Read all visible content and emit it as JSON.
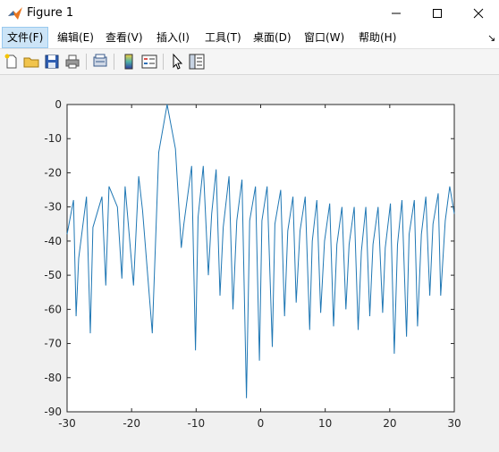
{
  "window": {
    "title": "Figure 1",
    "minimize_glyph": "—",
    "maximize_glyph": "☐",
    "close_glyph": "✕"
  },
  "menu": {
    "items": [
      "文件(F)",
      "编辑(E)",
      "查看(V)",
      "插入(I)",
      "工具(T)",
      "桌面(D)",
      "窗口(W)",
      "帮助(H)"
    ],
    "overflow_glyph": "↘"
  },
  "toolbar": {
    "icons": [
      "new-figure-icon",
      "open-file-icon",
      "save-icon",
      "print-icon",
      "print-preview-icon",
      "colorbar-icon",
      "legend-icon",
      "pointer-icon",
      "property-inspector-icon"
    ]
  },
  "colors": {
    "series": "#1f77b4",
    "axes": "#262626",
    "menu_active": "#cce4f7"
  },
  "chart_data": {
    "type": "line",
    "xlim": [
      -30,
      30
    ],
    "ylim": [
      -90,
      0
    ],
    "xticks": [
      "-30",
      "-20",
      "-10",
      "0",
      "10",
      "20",
      "30"
    ],
    "yticks": [
      "0",
      "-10",
      "-20",
      "-30",
      "-40",
      "-50",
      "-60",
      "-70",
      "-80",
      "-90"
    ],
    "grid": false,
    "series": [
      {
        "x": [
          -30,
          -29.0,
          -28.6,
          -28.2,
          -27.0,
          -26.4,
          -26.0,
          -24.6,
          -24.0,
          -23.5,
          -22.2,
          -21.5,
          -21.0,
          -19.7,
          -18.9,
          -18.3,
          -16.8,
          -15.8,
          -14.5,
          -13.2,
          -12.3,
          -11.9,
          -10.7,
          -10.1,
          -9.7,
          -8.9,
          -8.1,
          -7.6,
          -6.9,
          -6.3,
          -5.8,
          -4.9,
          -4.3,
          -3.7,
          -2.9,
          -2.2,
          -1.7,
          -0.8,
          -0.2,
          0.2,
          1.0,
          1.8,
          2.2,
          3.1,
          3.7,
          4.2,
          5.0,
          5.5,
          6.1,
          6.9,
          7.6,
          8.0,
          8.7,
          9.3,
          9.9,
          10.7,
          11.3,
          11.8,
          12.6,
          13.2,
          13.7,
          14.5,
          15.1,
          15.6,
          16.3,
          16.9,
          17.4,
          18.2,
          18.9,
          19.3,
          20.1,
          20.7,
          21.2,
          21.9,
          22.6,
          23.0,
          23.8,
          24.3,
          24.9,
          25.6,
          26.2,
          26.7,
          27.5,
          27.9,
          28.6,
          29.3,
          30
        ],
        "y": [
          -38,
          -28,
          -62,
          -45,
          -27,
          -67,
          -36,
          -27,
          -53,
          -24,
          -30,
          -51,
          -24,
          -53,
          -21,
          -31,
          -67,
          -14,
          0,
          -13,
          -42,
          -35,
          -18,
          -72,
          -33,
          -18,
          -50,
          -32,
          -19,
          -56,
          -36,
          -21,
          -60,
          -34,
          -22,
          -86,
          -34,
          -24,
          -75,
          -34,
          -24,
          -71,
          -35,
          -25,
          -62,
          -37,
          -27,
          -58,
          -37,
          -27,
          -66,
          -40,
          -28,
          -61,
          -40,
          -29,
          -65,
          -41,
          -30,
          -60,
          -41,
          -30,
          -66,
          -43,
          -30,
          -62,
          -41,
          -30,
          -61,
          -42,
          -29,
          -73,
          -41,
          -28,
          -68,
          -38,
          -28,
          -65,
          -38,
          -27,
          -56,
          -35,
          -26,
          -56,
          -34,
          -24,
          -32
        ]
      }
    ]
  }
}
